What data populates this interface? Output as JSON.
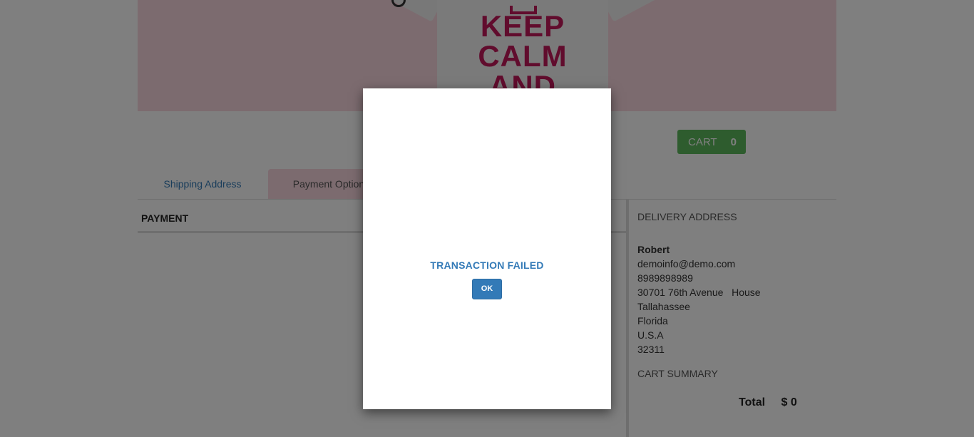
{
  "hero": {
    "shirt_text": "KEEP CALM AND",
    "accent_color": "#c2185b"
  },
  "cart": {
    "label": "CART",
    "count": "0",
    "color": "#5cb85c"
  },
  "tabs": [
    {
      "label": "Shipping Address"
    },
    {
      "label": "Payment Option"
    }
  ],
  "payment": {
    "heading": "PAYMENT"
  },
  "delivery": {
    "heading": "DELIVERY ADDRESS",
    "name": "Robert",
    "email": "demoinfo@demo.com",
    "phone": "8989898989",
    "street": "30701 76th Avenue   House",
    "city": "Tallahassee",
    "state": "Florida",
    "country": "U.S.A",
    "zip": "32311"
  },
  "cart_summary": {
    "heading": "CART SUMMARY",
    "total_label": "Total",
    "total_value": "$ 0"
  },
  "modal": {
    "message": "TRANSACTION FAILED",
    "ok_label": "OK"
  }
}
